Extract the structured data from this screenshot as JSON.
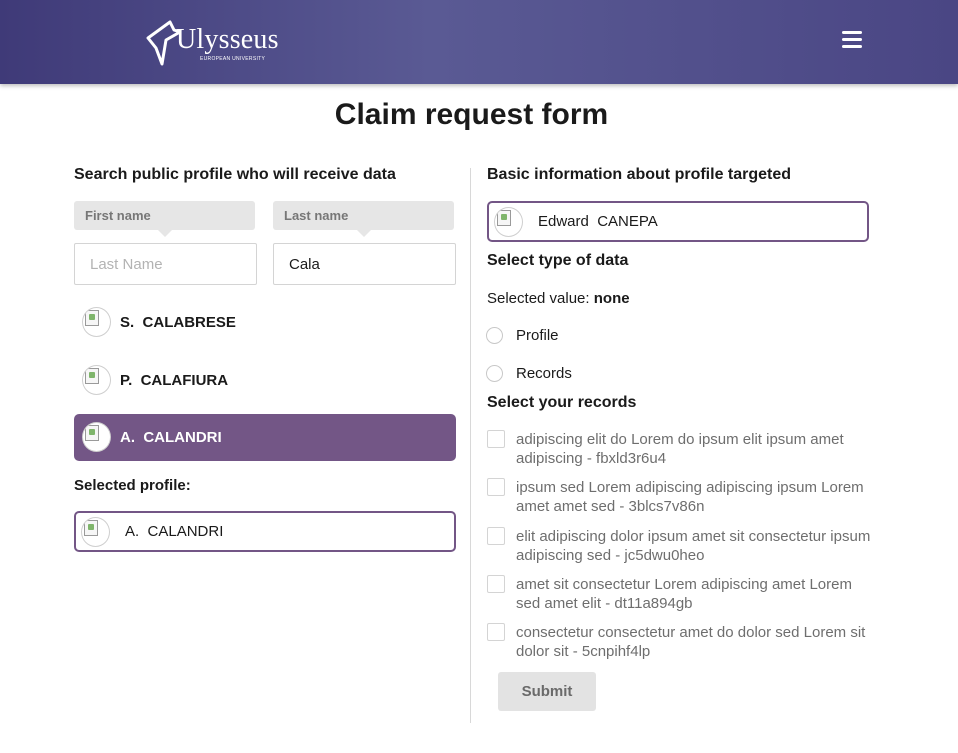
{
  "header": {
    "logo_text": "Ulysseus",
    "logo_subtext": "EUROPEAN UNIVERSITY",
    "menu_icon": "hamburger-menu-icon"
  },
  "page_title": "Claim request form",
  "search": {
    "title": "Search public profile who will receive data",
    "first_name_label": "First name",
    "last_name_label": "Last name",
    "first_name_placeholder": "Last Name",
    "first_name_value": "",
    "last_name_value": "Cala",
    "results": [
      {
        "initial": "S.",
        "surname": "CALABRESE",
        "selected": false
      },
      {
        "initial": "P.",
        "surname": "CALAFIURA",
        "selected": false
      },
      {
        "initial": "A.",
        "surname": "CALANDRI",
        "selected": true
      }
    ],
    "selected_label": "Selected profile:",
    "selected_profile": {
      "initial": "A.",
      "surname": "CALANDRI"
    }
  },
  "target": {
    "title": "Basic information about profile targeted",
    "profile": {
      "first": "Edward",
      "surname": "CANEPA"
    }
  },
  "data_type": {
    "title": "Select type of data",
    "selected_prefix": "Selected value:",
    "selected_value": "none",
    "options": [
      "Profile",
      "Records"
    ]
  },
  "records": {
    "title": "Select your records",
    "items": [
      "adipiscing elit do Lorem do ipsum elit ipsum amet adipiscing - fbxld3r6u4",
      "ipsum sed Lorem adipiscing adipiscing ipsum Lorem amet amet sed - 3blcs7v86n",
      "elit adipiscing dolor ipsum amet sit consectetur ipsum adipiscing sed - jc5dwu0heo",
      "amet sit consectetur Lorem adipiscing amet Lorem sed amet elit - dt11a894gb",
      "consectetur consectetur amet do dolor sed Lorem sit dolor sit - 5cnpihf4lp"
    ]
  },
  "submit_label": "Submit",
  "colors": {
    "header_gradient_start": "#3f3a78",
    "header_gradient_mid": "#5a5a94",
    "accent": "#735686"
  }
}
